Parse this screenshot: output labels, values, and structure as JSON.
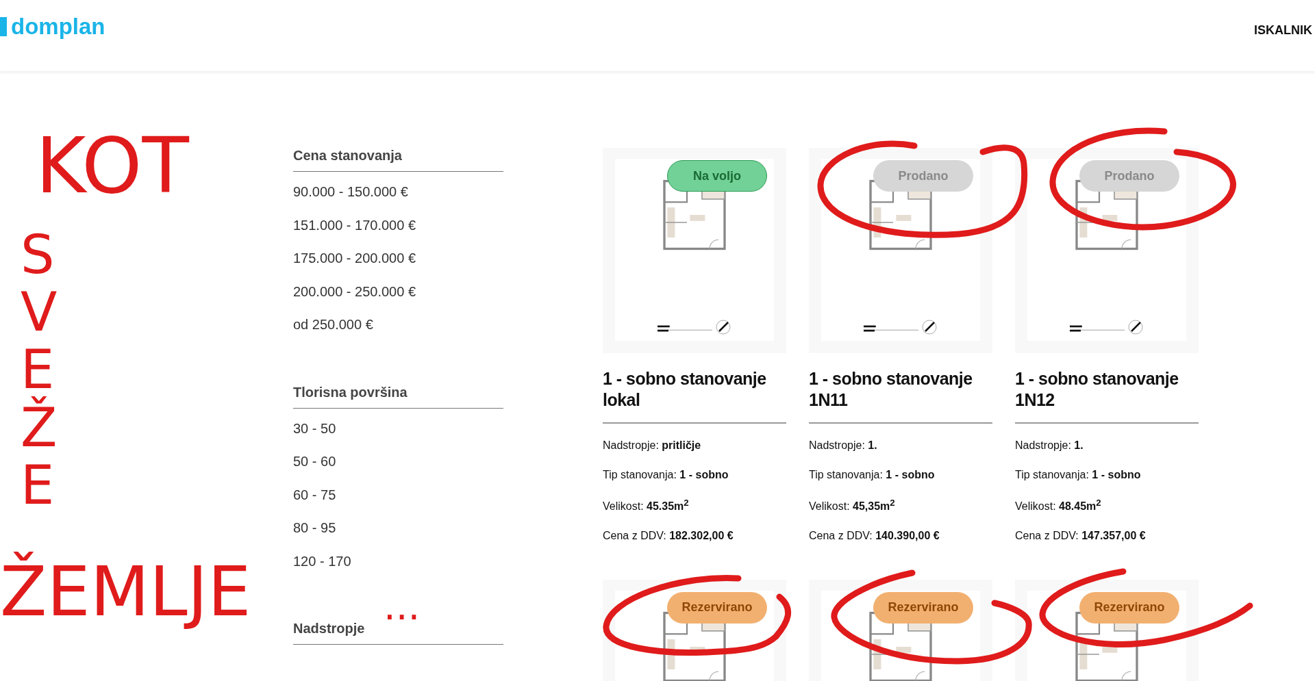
{
  "header": {
    "logo": "domplan",
    "nav": [
      "ISKALNIK"
    ]
  },
  "filters": [
    {
      "title": "Cena stanovanja",
      "options": [
        "90.000 - 150.000 €",
        "151.000 - 170.000 €",
        "175.000 - 200.000 €",
        "200.000 - 250.000 €",
        "od 250.000 €"
      ]
    },
    {
      "title": "Tlorisna površina",
      "options": [
        "30 - 50",
        "50 - 60",
        "60 - 75",
        "80 - 95",
        "120 - 170"
      ]
    },
    {
      "title": "Nadstropje"
    }
  ],
  "listings": [
    {
      "status": "Na voljo",
      "kind": "available",
      "title": "1 - sobno stanovanje lokal",
      "details": [
        "Nadstropje: **pritličje**",
        "Tip stanovanja: **1 - sobno**",
        "Velikost: **45.35m$^{2}$**",
        "Cena z DDV: **182.302,00 €**"
      ]
    },
    {
      "status": "Prodano",
      "kind": "sold",
      "title": "1 - sobno stanovanje 1N11",
      "details": [
        "Nadstropje: **1.**",
        "Tip stanovanja: **1 - sobno**",
        "Velikost: **45,35m$^{2}$**",
        "Cena z DDV: **140.390,00 €**"
      ]
    },
    {
      "status": "Prodano",
      "kind": "sold",
      "title": "1 - sobno stanovanje 1N12",
      "details": [
        "Nadstropje: **1.**",
        "Tip stanovanja: **1 - sobno**",
        "Velikost: **48.45m$^{2}$**",
        "Cena z DDV: **147.357,00 €**"
      ]
    },
    {
      "status": "Rezervirano",
      "kind": "reserved"
    },
    {
      "status": "Rezervirano",
      "kind": "reserved"
    },
    {
      "status": "Rezervirano",
      "kind": "reserved"
    }
  ],
  "annotations": [
    {
      "text": "KOT",
      "kind": "horizontal"
    },
    {
      "text": "SVEŽE",
      "kind": "vertical"
    },
    {
      "text": "ŽEMLJE",
      "kind": "horizontal"
    },
    {
      "text": "...",
      "kind": "horizontal"
    }
  ]
}
